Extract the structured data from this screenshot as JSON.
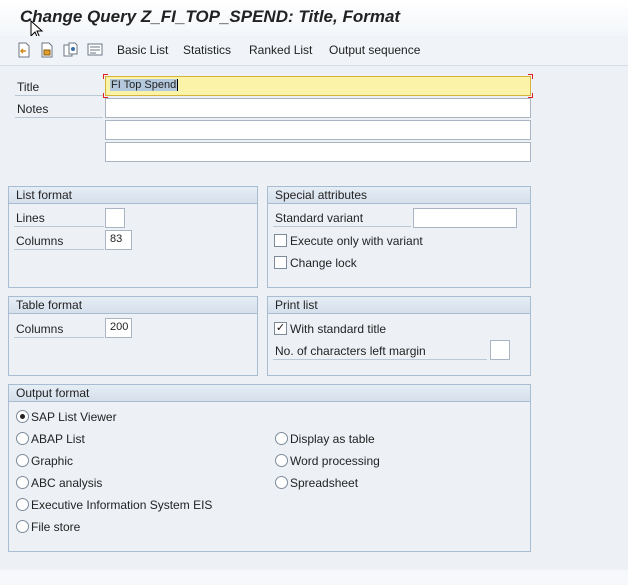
{
  "window": {
    "title": "Change Query Z_FI_TOP_SPEND: Title, Format"
  },
  "toolbar": {
    "icons": [
      "back-page-icon",
      "save-page-icon",
      "copy-pages-icon",
      "print-preview-icon"
    ],
    "buttons": [
      "Basic List",
      "Statistics",
      "Ranked List",
      "Output sequence"
    ]
  },
  "header": {
    "title_label": "Title",
    "title_value": "FI Top Spend",
    "notes_label": "Notes",
    "notes_lines": [
      "",
      "",
      ""
    ]
  },
  "list_format": {
    "heading": "List format",
    "lines_label": "Lines",
    "lines_value": "",
    "columns_label": "Columns",
    "columns_value": "83"
  },
  "special_attributes": {
    "heading": "Special attributes",
    "standard_variant_label": "Standard variant",
    "standard_variant_value": "",
    "execute_only_label": "Execute only with variant",
    "execute_only_checked": false,
    "change_lock_label": "Change lock",
    "change_lock_checked": false
  },
  "table_format": {
    "heading": "Table format",
    "columns_label": "Columns",
    "columns_value": "200"
  },
  "print_list": {
    "heading": "Print list",
    "standard_title_label": "With standard title",
    "standard_title_checked": true,
    "check_mark": "✓",
    "left_margin_label": "No. of characters left margin",
    "left_margin_value": ""
  },
  "output_format": {
    "heading": "Output format",
    "selected": "SAP List Viewer",
    "options": [
      "SAP List Viewer",
      "ABAP List",
      "Graphic",
      "ABC analysis",
      "Executive Information System EIS",
      "File store",
      "Display as table",
      "Word processing",
      "Spreadsheet"
    ]
  },
  "colors": {
    "background": "#edf1f6",
    "focused_field": "#fbf3a8",
    "selection": "#b3c8dd",
    "group_border": "#a9bdd2"
  }
}
